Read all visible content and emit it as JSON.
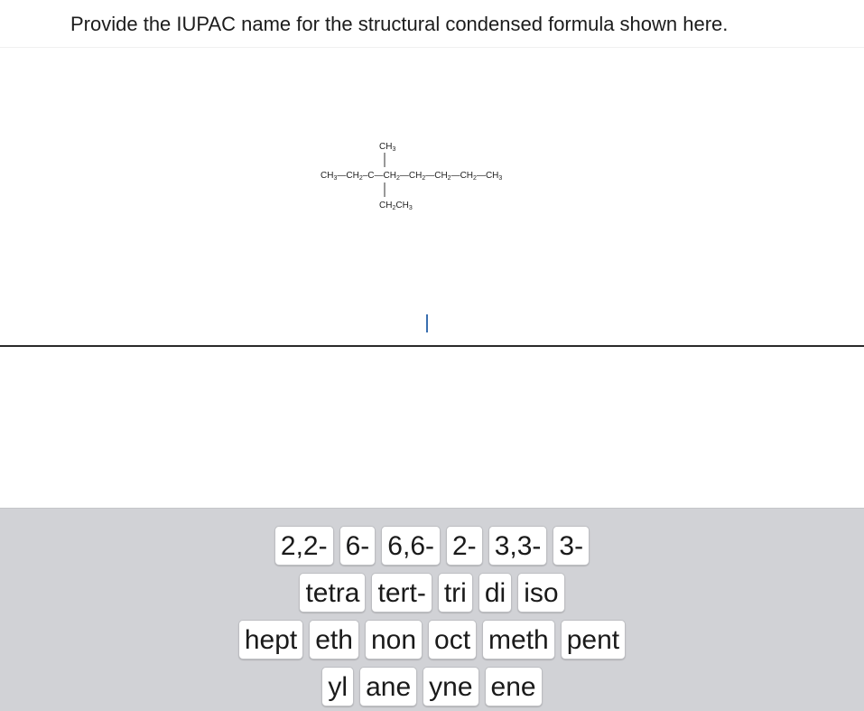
{
  "question": {
    "text": "Provide the IUPAC name for the structural condensed formula shown here."
  },
  "structure": {
    "top_substituent": "CH3",
    "main_chain": [
      "CH3",
      "CH2",
      "C",
      "CH2",
      "CH2",
      "CH2",
      "CH2",
      "CH3"
    ],
    "bottom_substituent": "CH2CH3"
  },
  "answer": {
    "value": ""
  },
  "tiles": {
    "row1": [
      "2,2-",
      "6-",
      "6,6-",
      "2-",
      "3,3-",
      "3-"
    ],
    "row2": [
      "tetra",
      "tert-",
      "tri",
      "di",
      "iso"
    ],
    "row3": [
      "hept",
      "eth",
      "non",
      "oct",
      "meth",
      "pent"
    ],
    "row4": [
      "yl",
      "ane",
      "yne",
      "ene"
    ]
  },
  "colors": {
    "tray_background": "#d1d2d6",
    "tile_background": "#ffffff",
    "caret": "#3a6fb0"
  }
}
